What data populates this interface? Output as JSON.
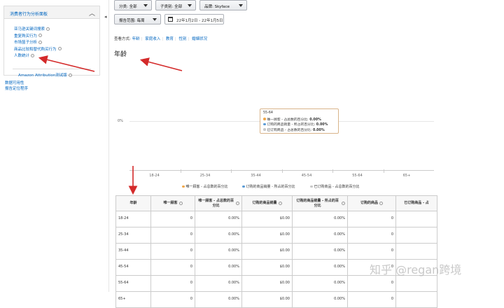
{
  "sidebar": {
    "group_title": "消费者行为分析面板",
    "items": [
      {
        "label": "亚马逊关键词搜索"
      },
      {
        "label": "重复购买行为"
      },
      {
        "label": "市场篮子分析"
      },
      {
        "label": "商品比较和替代购买行为"
      },
      {
        "label": "人数统计"
      }
    ],
    "attribution": "Amazon Attribution测试版",
    "footer_links": [
      "数据可用性",
      "报告定位程序"
    ]
  },
  "filters": {
    "category": "分类: 全部",
    "subcategory": "子类别: 全部",
    "brand": "品牌: Skyface",
    "report_range": "报告范围: 每周",
    "date_range": "22年1月2日 - 22年1月5日"
  },
  "views": {
    "label": "查看方式:",
    "options": [
      "年龄",
      "家庭收入",
      "教育",
      "性别",
      "婚姻状况"
    ]
  },
  "page_title": "年龄",
  "chart_data": {
    "type": "line",
    "x": [
      "18-24",
      "25-34",
      "35-44",
      "45-54",
      "55-64",
      "65+"
    ],
    "y_tick_label": "0%",
    "series": [
      {
        "name": "唯一顾客 - 占总数的百分比",
        "color": "#f0a84c",
        "values": [
          0,
          0,
          0,
          0,
          0,
          0
        ]
      },
      {
        "name": "订购的商品销量 - 所占的百分比",
        "color": "#5b9bd5",
        "values": [
          0,
          0,
          0,
          0,
          0,
          0
        ]
      },
      {
        "name": "已订购商品 - 占总数的百分比",
        "color": "#c8c8c8",
        "values": [
          0,
          0,
          0,
          0,
          0,
          0
        ]
      }
    ],
    "tooltip": {
      "title": "55-64",
      "rows": [
        {
          "label": "唯一顾客 - 占总数的百分比:",
          "value": "0.00%",
          "color": "#f0a84c"
        },
        {
          "label": "订购的商品销量 - 所占的百分比:",
          "value": "0.00%",
          "color": "#5b9bd5"
        },
        {
          "label": "已订购商品 - 占总数的百分比:",
          "value": "0.00%",
          "color": "#c8c8c8"
        }
      ]
    }
  },
  "table": {
    "headers": [
      "年龄",
      "唯一顾客",
      "唯一顾客 - 占总数的百分比",
      "订购的商品销量",
      "订购的商品销量 - 所占的百分比",
      "订购的商品",
      "已订购商品 - 占"
    ],
    "rows": [
      [
        "18-24",
        "0",
        "0.00%",
        "$0.00",
        "0.00%",
        "0",
        ""
      ],
      [
        "25-34",
        "0",
        "0.00%",
        "$0.00",
        "0.00%",
        "0",
        ""
      ],
      [
        "35-44",
        "0",
        "0.00%",
        "$0.00",
        "0.00%",
        "0",
        ""
      ],
      [
        "45-54",
        "0",
        "0.00%",
        "$0.00",
        "0.00%",
        "0",
        ""
      ],
      [
        "55-64",
        "0",
        "0.00%",
        "$0.00",
        "0.00%",
        "0",
        ""
      ],
      [
        "65+",
        "0",
        "0.00%",
        "$0.00",
        "0.00%",
        "0",
        ""
      ]
    ]
  },
  "watermark": "知乎 @regan跨境"
}
